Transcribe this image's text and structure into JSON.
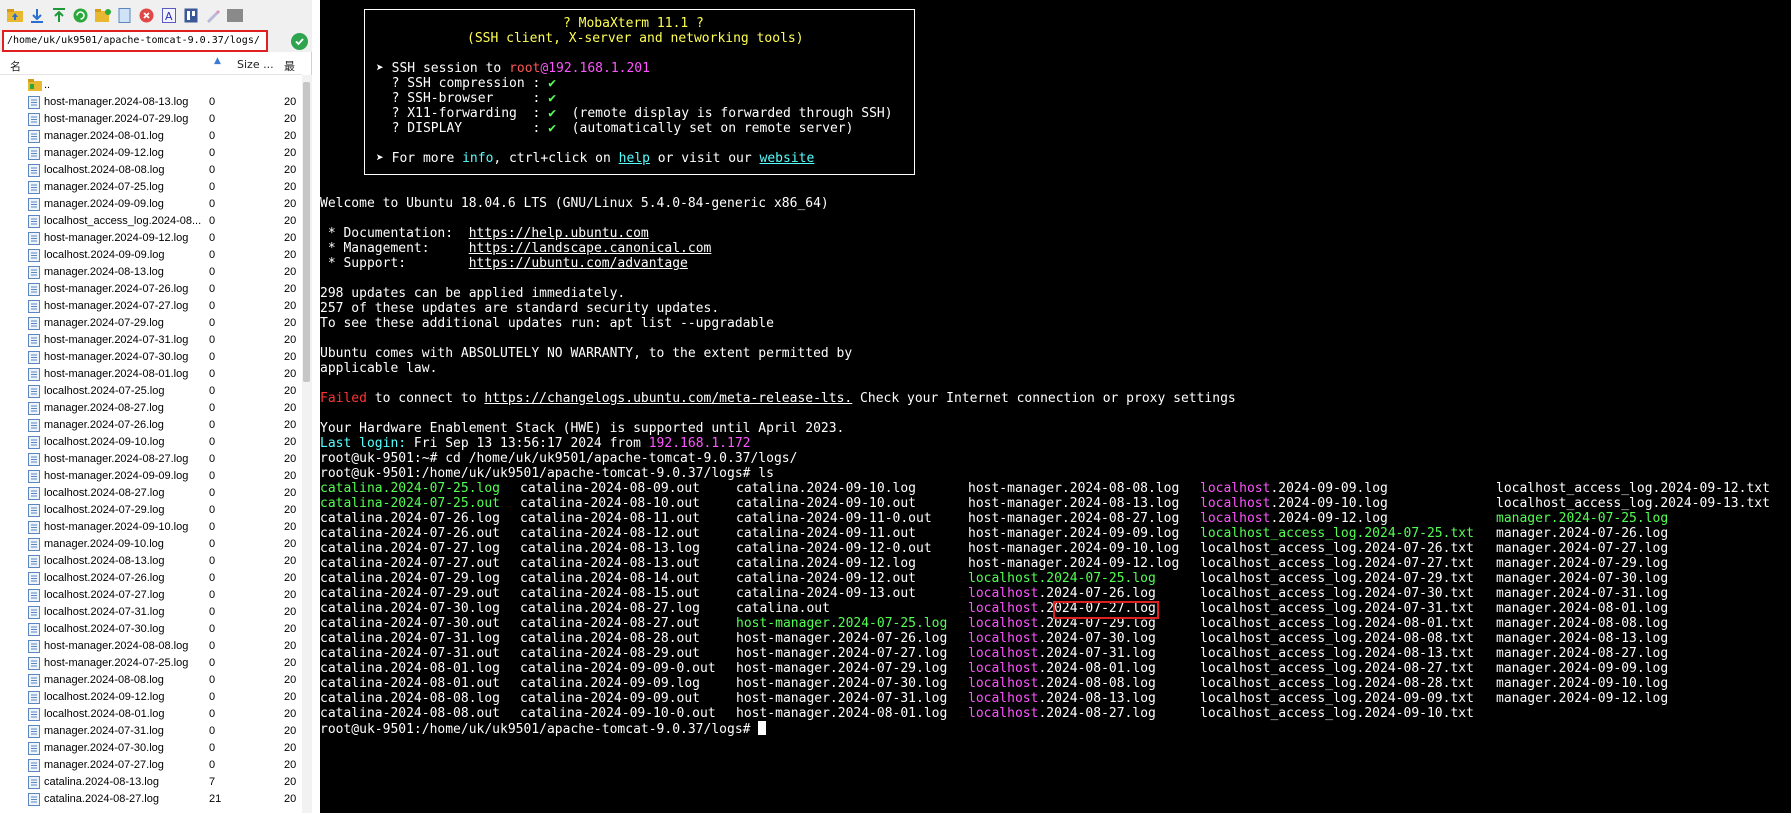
{
  "sftp": {
    "path": "/home/uk/uk9501/apache-tomcat-9.0.37/logs/",
    "toolbar_icons": [
      "folder-up-icon",
      "download-icon",
      "upload-icon",
      "refresh-icon",
      "new-folder-icon",
      "new-file-icon",
      "delete-icon",
      "rename-icon",
      "permissions-icon",
      "edit-icon",
      "terminal-icon"
    ],
    "columns": {
      "name": "名",
      "size": "Size ...",
      "modified": "最"
    },
    "parent": "..",
    "files": [
      {
        "name": "host-manager.2024-08-13.log",
        "size": "0",
        "date": "20"
      },
      {
        "name": "host-manager.2024-07-29.log",
        "size": "0",
        "date": "20"
      },
      {
        "name": "manager.2024-08-01.log",
        "size": "0",
        "date": "20"
      },
      {
        "name": "manager.2024-09-12.log",
        "size": "0",
        "date": "20"
      },
      {
        "name": "localhost.2024-08-08.log",
        "size": "0",
        "date": "20"
      },
      {
        "name": "manager.2024-07-25.log",
        "size": "0",
        "date": "20"
      },
      {
        "name": "manager.2024-09-09.log",
        "size": "0",
        "date": "20"
      },
      {
        "name": "localhost_access_log.2024-08...",
        "size": "0",
        "date": "20"
      },
      {
        "name": "host-manager.2024-09-12.log",
        "size": "0",
        "date": "20"
      },
      {
        "name": "localhost.2024-09-09.log",
        "size": "0",
        "date": "20"
      },
      {
        "name": "manager.2024-08-13.log",
        "size": "0",
        "date": "20"
      },
      {
        "name": "host-manager.2024-07-26.log",
        "size": "0",
        "date": "20"
      },
      {
        "name": "host-manager.2024-07-27.log",
        "size": "0",
        "date": "20"
      },
      {
        "name": "manager.2024-07-29.log",
        "size": "0",
        "date": "20"
      },
      {
        "name": "host-manager.2024-07-31.log",
        "size": "0",
        "date": "20"
      },
      {
        "name": "host-manager.2024-07-30.log",
        "size": "0",
        "date": "20"
      },
      {
        "name": "host-manager.2024-08-01.log",
        "size": "0",
        "date": "20"
      },
      {
        "name": "localhost.2024-07-25.log",
        "size": "0",
        "date": "20"
      },
      {
        "name": "manager.2024-08-27.log",
        "size": "0",
        "date": "20"
      },
      {
        "name": "manager.2024-07-26.log",
        "size": "0",
        "date": "20"
      },
      {
        "name": "localhost.2024-09-10.log",
        "size": "0",
        "date": "20"
      },
      {
        "name": "host-manager.2024-08-27.log",
        "size": "0",
        "date": "20"
      },
      {
        "name": "host-manager.2024-09-09.log",
        "size": "0",
        "date": "20"
      },
      {
        "name": "localhost.2024-08-27.log",
        "size": "0",
        "date": "20"
      },
      {
        "name": "localhost.2024-07-29.log",
        "size": "0",
        "date": "20"
      },
      {
        "name": "host-manager.2024-09-10.log",
        "size": "0",
        "date": "20"
      },
      {
        "name": "manager.2024-09-10.log",
        "size": "0",
        "date": "20"
      },
      {
        "name": "localhost.2024-08-13.log",
        "size": "0",
        "date": "20"
      },
      {
        "name": "localhost.2024-07-26.log",
        "size": "0",
        "date": "20"
      },
      {
        "name": "localhost.2024-07-27.log",
        "size": "0",
        "date": "20"
      },
      {
        "name": "localhost.2024-07-31.log",
        "size": "0",
        "date": "20"
      },
      {
        "name": "localhost.2024-07-30.log",
        "size": "0",
        "date": "20"
      },
      {
        "name": "host-manager.2024-08-08.log",
        "size": "0",
        "date": "20"
      },
      {
        "name": "host-manager.2024-07-25.log",
        "size": "0",
        "date": "20"
      },
      {
        "name": "manager.2024-08-08.log",
        "size": "0",
        "date": "20"
      },
      {
        "name": "localhost.2024-09-12.log",
        "size": "0",
        "date": "20"
      },
      {
        "name": "localhost.2024-08-01.log",
        "size": "0",
        "date": "20"
      },
      {
        "name": "manager.2024-07-31.log",
        "size": "0",
        "date": "20"
      },
      {
        "name": "manager.2024-07-30.log",
        "size": "0",
        "date": "20"
      },
      {
        "name": "manager.2024-07-27.log",
        "size": "0",
        "date": "20"
      },
      {
        "name": "catalina.2024-08-13.log",
        "size": "7",
        "date": "20"
      },
      {
        "name": "catalina.2024-08-27.log",
        "size": "21",
        "date": "20"
      }
    ]
  },
  "terminal": {
    "banner": {
      "title": "? MobaXterm 11.1 ?",
      "subtitle": "(SSH client, X-server and networking tools)",
      "session_prefix": "➤ SSH session to ",
      "user": "root",
      "host": "@192.168.1.201",
      "features": [
        {
          "label": "  ? SSH compression : ",
          "check": "✔",
          "note": ""
        },
        {
          "label": "  ? SSH-browser     : ",
          "check": "✔",
          "note": ""
        },
        {
          "label": "  ? X11-forwarding  : ",
          "check": "✔",
          "note": "  (remote display is forwarded through SSH)"
        },
        {
          "label": "  ? DISPLAY         : ",
          "check": "✔",
          "note": "  (automatically set on remote server)"
        }
      ],
      "more_prefix": "➤ For more ",
      "more_info": "info",
      "more_mid": ", ctrl+click on ",
      "more_help": "help",
      "more_or": " or visit our ",
      "more_website": "website"
    },
    "welcome": "Welcome to Ubuntu 18.04.6 LTS (GNU/Linux 5.4.0-84-generic x86_64)",
    "docs_label": " * Documentation:  ",
    "docs_url": "https://help.ubuntu.com",
    "mgmt_label": " * Management:     ",
    "mgmt_url": "https://landscape.canonical.com",
    "support_label": " * Support:        ",
    "support_url": "https://ubuntu.com/advantage",
    "updates1": "298 updates can be applied immediately.",
    "updates2": "257 of these updates are standard security updates.",
    "updates3": "To see these additional updates run: apt list --upgradable",
    "warranty1": "Ubuntu comes with ABSOLUTELY NO WARRANTY, to the extent permitted by",
    "warranty2": "applicable law.",
    "failed_word": "Failed",
    "failed_mid": " to connect to ",
    "failed_url": "https://changelogs.ubuntu.com/meta-release-lts.",
    "failed_end": " Check your Internet connection or proxy settings",
    "hwe": "Your Hardware Enablement Stack (HWE) is supported until April 2023.",
    "last_login_label": "Last login:",
    "last_login_text": " Fri Sep 13 13:56:17 2024 from ",
    "last_login_ip": "192.168.1.172",
    "prompt1": "root@uk-9501:~# cd /home/uk/uk9501/apache-tomcat-9.0.37/logs/",
    "prompt2": "root@uk-9501:/home/uk/uk9501/apache-tomcat-9.0.37/logs# ls",
    "prompt3": "root@uk-9501:/home/uk/uk9501/apache-tomcat-9.0.37/logs# ",
    "ls_columns": [
      [
        {
          "t": "catalina.2024-07-25.log",
          "c": "g"
        },
        {
          "t": "catalina-2024-07-25.out",
          "c": "g"
        },
        {
          "t": "catalina.2024-07-26.log",
          "c": ""
        },
        {
          "t": "catalina-2024-07-26.out",
          "c": ""
        },
        {
          "t": "catalina.2024-07-27.log",
          "c": ""
        },
        {
          "t": "catalina-2024-07-27.out",
          "c": ""
        },
        {
          "t": "catalina.2024-07-29.log",
          "c": ""
        },
        {
          "t": "catalina-2024-07-29.out",
          "c": ""
        },
        {
          "t": "catalina.2024-07-30.log",
          "c": ""
        },
        {
          "t": "catalina-2024-07-30.out",
          "c": ""
        },
        {
          "t": "catalina.2024-07-31.log",
          "c": ""
        },
        {
          "t": "catalina-2024-07-31.out",
          "c": ""
        },
        {
          "t": "catalina.2024-08-01.log",
          "c": ""
        },
        {
          "t": "catalina-2024-08-01.out",
          "c": ""
        },
        {
          "t": "catalina.2024-08-08.log",
          "c": ""
        },
        {
          "t": "catalina-2024-08-08.out",
          "c": ""
        }
      ],
      [
        {
          "t": "catalina-2024-08-09.out",
          "c": ""
        },
        {
          "t": "catalina-2024-08-10.out",
          "c": ""
        },
        {
          "t": "catalina-2024-08-11.out",
          "c": ""
        },
        {
          "t": "catalina-2024-08-12.out",
          "c": ""
        },
        {
          "t": "catalina.2024-08-13.log",
          "c": ""
        },
        {
          "t": "catalina-2024-08-13.out",
          "c": ""
        },
        {
          "t": "catalina.2024-08-14.out",
          "c": ""
        },
        {
          "t": "catalina-2024-08-15.out",
          "c": ""
        },
        {
          "t": "catalina.2024-08-27.log",
          "c": ""
        },
        {
          "t": "catalina-2024-08-27.out",
          "c": ""
        },
        {
          "t": "catalina.2024-08-28.out",
          "c": ""
        },
        {
          "t": "catalina-2024-08-29.out",
          "c": ""
        },
        {
          "t": "catalina-2024-09-09-0.out",
          "c": ""
        },
        {
          "t": "catalina.2024-09-09.log",
          "c": ""
        },
        {
          "t": "catalina-2024-09-09.out",
          "c": ""
        },
        {
          "t": "catalina-2024-09-10-0.out",
          "c": ""
        }
      ],
      [
        {
          "t": "catalina.2024-09-10.log",
          "c": ""
        },
        {
          "t": "catalina-2024-09-10.out",
          "c": ""
        },
        {
          "t": "catalina-2024-09-11-0.out",
          "c": ""
        },
        {
          "t": "catalina-2024-09-11.out",
          "c": ""
        },
        {
          "t": "catalina-2024-09-12-0.out",
          "c": ""
        },
        {
          "t": "catalina.2024-09-12.log",
          "c": ""
        },
        {
          "t": "catalina-2024-09-12.out",
          "c": ""
        },
        {
          "t": "catalina-2024-09-13.out",
          "c": ""
        },
        {
          "t": "catalina.out",
          "c": "",
          "highlight": true
        },
        {
          "t": "host-manager.2024-07-25.log",
          "c": "g"
        },
        {
          "t": "host-manager.2024-07-26.log",
          "c": ""
        },
        {
          "t": "host-manager.2024-07-27.log",
          "c": ""
        },
        {
          "t": "host-manager.2024-07-29.log",
          "c": ""
        },
        {
          "t": "host-manager.2024-07-30.log",
          "c": ""
        },
        {
          "t": "host-manager.2024-07-31.log",
          "c": ""
        },
        {
          "t": "host-manager.2024-08-01.log",
          "c": ""
        }
      ],
      [
        {
          "t": "host-manager.2024-08-08.log",
          "c": ""
        },
        {
          "t": "host-manager.2024-08-13.log",
          "c": ""
        },
        {
          "t": "host-manager.2024-08-27.log",
          "c": ""
        },
        {
          "t": "host-manager.2024-09-09.log",
          "c": ""
        },
        {
          "t": "host-manager.2024-09-10.log",
          "c": ""
        },
        {
          "t": "host-manager.2024-09-12.log",
          "c": ""
        },
        {
          "t": "localhost.2024-07-25.log",
          "c": "g"
        },
        {
          "t": "localhost.2024-07-26.log",
          "c": "mh"
        },
        {
          "t": "localhost.2024-07-27.log",
          "c": "mh"
        },
        {
          "t": "localhost.2024-07-29.log",
          "c": "mh"
        },
        {
          "t": "localhost.2024-07-30.log",
          "c": "mh"
        },
        {
          "t": "localhost.2024-07-31.log",
          "c": "mh"
        },
        {
          "t": "localhost.2024-08-01.log",
          "c": "mh"
        },
        {
          "t": "localhost.2024-08-08.log",
          "c": "mh"
        },
        {
          "t": "localhost.2024-08-13.log",
          "c": "mh"
        },
        {
          "t": "localhost.2024-08-27.log",
          "c": "mh"
        }
      ],
      [
        {
          "t": "localhost.2024-09-09.log",
          "c": "mh"
        },
        {
          "t": "localhost.2024-09-10.log",
          "c": "mh"
        },
        {
          "t": "localhost.2024-09-12.log",
          "c": "mh"
        },
        {
          "t": "localhost_access_log.2024-07-25.txt",
          "c": "g"
        },
        {
          "t": "localhost_access_log.2024-07-26.txt",
          "c": ""
        },
        {
          "t": "localhost_access_log.2024-07-27.txt",
          "c": ""
        },
        {
          "t": "localhost_access_log.2024-07-29.txt",
          "c": ""
        },
        {
          "t": "localhost_access_log.2024-07-30.txt",
          "c": ""
        },
        {
          "t": "localhost_access_log.2024-07-31.txt",
          "c": ""
        },
        {
          "t": "localhost_access_log.2024-08-01.txt",
          "c": ""
        },
        {
          "t": "localhost_access_log.2024-08-08.txt",
          "c": ""
        },
        {
          "t": "localhost_access_log.2024-08-13.txt",
          "c": ""
        },
        {
          "t": "localhost_access_log.2024-08-27.txt",
          "c": ""
        },
        {
          "t": "localhost_access_log.2024-08-28.txt",
          "c": ""
        },
        {
          "t": "localhost_access_log.2024-09-09.txt",
          "c": ""
        },
        {
          "t": "localhost_access_log.2024-09-10.txt",
          "c": ""
        }
      ],
      [
        {
          "t": "localhost_access_log.2024-09-12.txt",
          "c": ""
        },
        {
          "t": "localhost_access_log.2024-09-13.txt",
          "c": ""
        },
        {
          "t": "manager.2024-07-25.log",
          "c": "g"
        },
        {
          "t": "manager.2024-07-26.log",
          "c": ""
        },
        {
          "t": "manager.2024-07-27.log",
          "c": ""
        },
        {
          "t": "manager.2024-07-29.log",
          "c": ""
        },
        {
          "t": "manager.2024-07-30.log",
          "c": ""
        },
        {
          "t": "manager.2024-07-31.log",
          "c": ""
        },
        {
          "t": "manager.2024-08-01.log",
          "c": ""
        },
        {
          "t": "manager.2024-08-08.log",
          "c": ""
        },
        {
          "t": "manager.2024-08-13.log",
          "c": ""
        },
        {
          "t": "manager.2024-08-27.log",
          "c": ""
        },
        {
          "t": "manager.2024-09-09.log",
          "c": ""
        },
        {
          "t": "manager.2024-09-10.log",
          "c": ""
        },
        {
          "t": "manager.2024-09-12.log",
          "c": ""
        }
      ]
    ]
  },
  "colors": {
    "terminal_bg": "#000000",
    "terminal_fg": "#ffffff",
    "green": "#55ff55",
    "magenta": "#ff55ff",
    "cyan": "#55ffff",
    "yellow": "#ffff55",
    "red": "#ff3333",
    "highlight_border": "#e02020"
  }
}
